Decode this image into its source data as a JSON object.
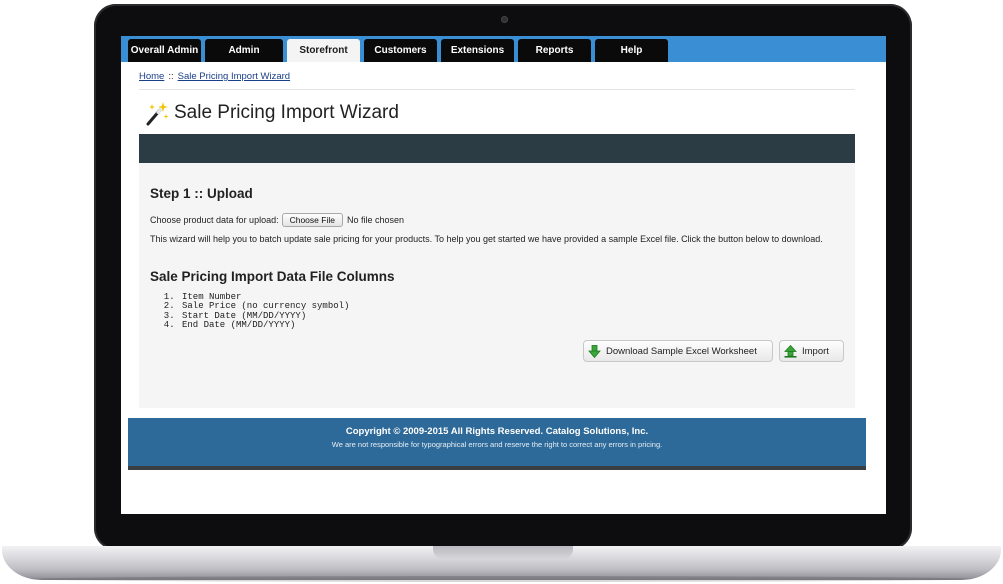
{
  "nav": {
    "tabs": [
      {
        "label": "Overall Admin",
        "active": false
      },
      {
        "label": "Admin",
        "active": false
      },
      {
        "label": "Storefront",
        "active": true
      },
      {
        "label": "Customers",
        "active": false
      },
      {
        "label": "Extensions",
        "active": false
      },
      {
        "label": "Reports",
        "active": false
      },
      {
        "label": "Help",
        "active": false
      }
    ]
  },
  "breadcrumb": {
    "home": "Home",
    "separator": "::",
    "current": "Sale Pricing Import Wizard"
  },
  "page": {
    "title": "Sale Pricing Import Wizard",
    "title_icon": "magic-wand-icon"
  },
  "step": {
    "heading": "Step 1 :: Upload",
    "upload_label": "Choose product data for upload:",
    "choose_button": "Choose File",
    "file_status": "No file chosen",
    "description": "This wizard will help you to batch update sale pricing for your products. To help you get started we have provided a sample Excel file. Click the button below to download."
  },
  "columns": {
    "heading": "Sale Pricing Import Data File Columns",
    "items": [
      "Item Number",
      "Sale Price (no currency symbol)",
      "Start Date (MM/DD/YYYY)",
      "End Date (MM/DD/YYYY)"
    ]
  },
  "actions": {
    "download_label": "Download Sample Excel Worksheet",
    "download_icon": "download-arrow-icon",
    "import_label": "Import",
    "import_icon": "upload-arrow-icon"
  },
  "footer": {
    "copyright": "Copyright © 2009-2015 All Rights Reserved. Catalog Solutions, Inc.",
    "disclaimer": "We are not responsible for typographical errors and reserve the right to correct any errors in pricing."
  },
  "colors": {
    "nav_bar": "#3a8fd4",
    "tab_bg": "#0a0a0a",
    "active_tab_bg": "#f4f4f4",
    "header_band": "#2c3c45",
    "footer_bg": "#2e6a99",
    "icon_green": "#3aa53a"
  }
}
